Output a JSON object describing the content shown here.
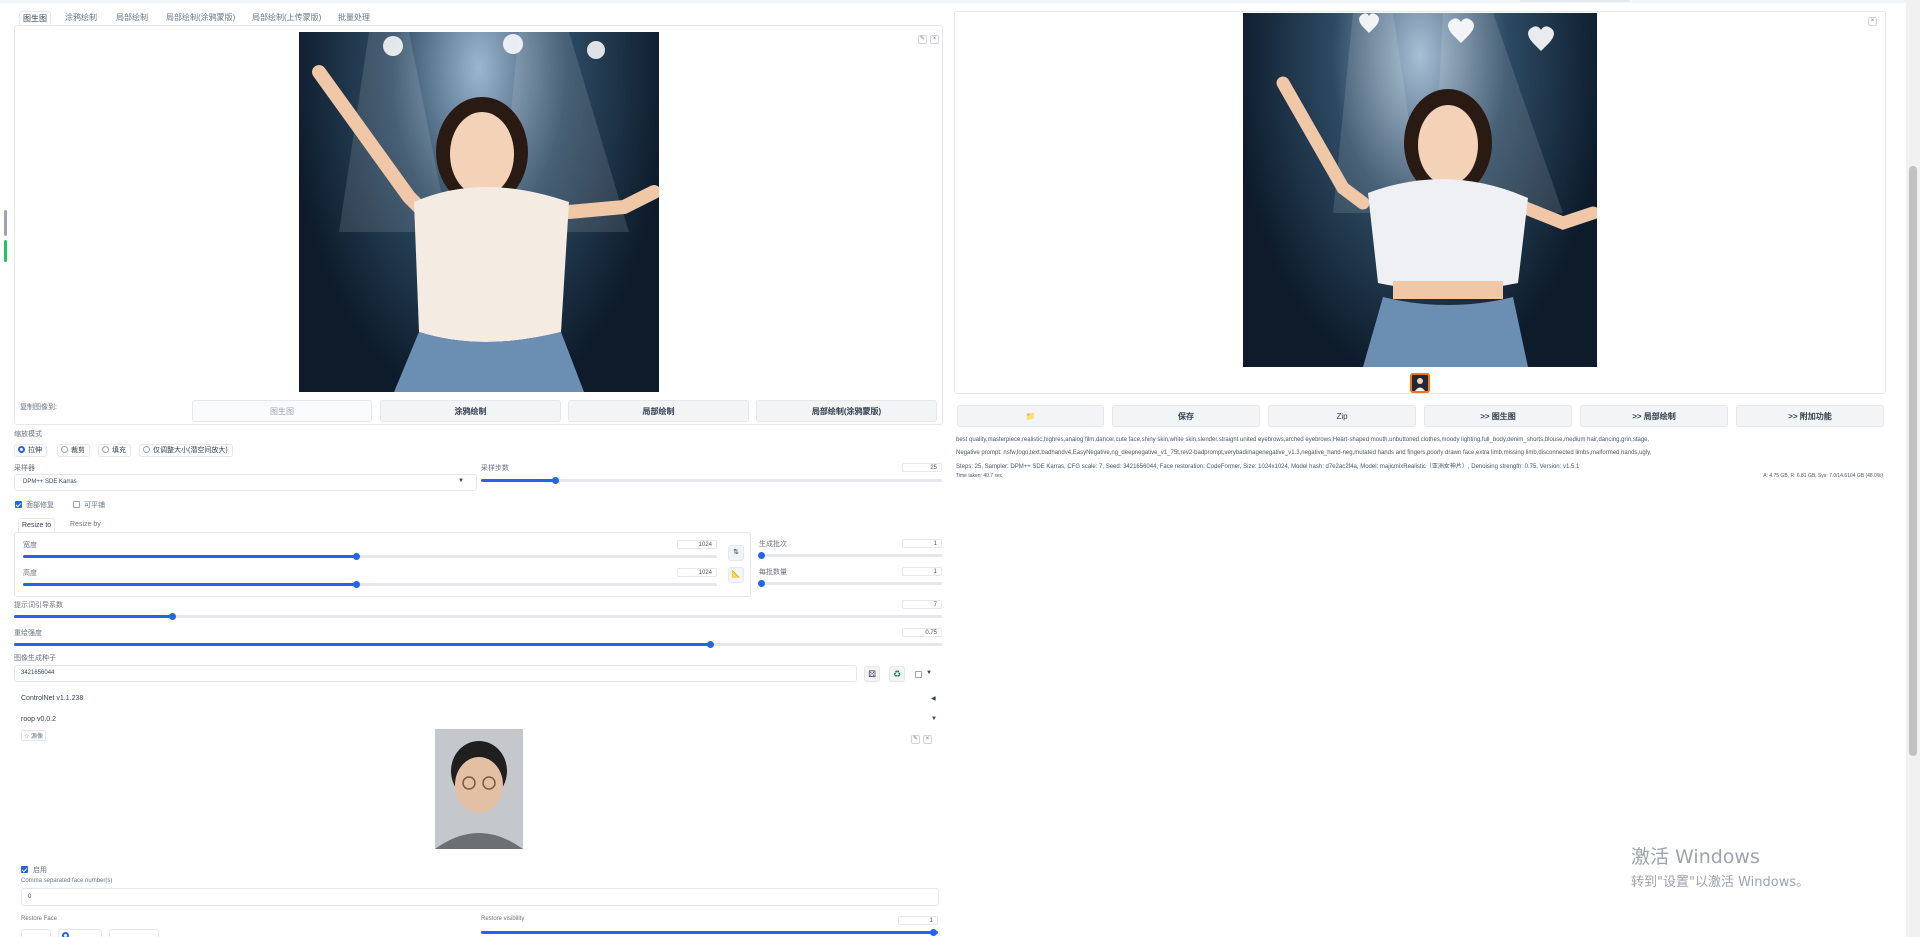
{
  "tabs": [
    "图生图",
    "涂鸦绘制",
    "局部绘制",
    "局部绘制(涂鸦蒙版)",
    "局部绘制(上传蒙版)",
    "批量处理"
  ],
  "copy_image": {
    "label": "复制图像到:",
    "buttons": [
      "图生图",
      "涂鸦绘制",
      "局部绘制",
      "局部绘制(涂鸦蒙版)"
    ]
  },
  "resize_mode": {
    "label": "缩放模式",
    "options": [
      "拉伸",
      "裁剪",
      "填充",
      "仅调整大小(潜空间放大)"
    ],
    "selected": "拉伸"
  },
  "sampler": {
    "label": "采样器",
    "value": "DPM++ SDE Karras"
  },
  "steps": {
    "label": "采样步数",
    "value": "25",
    "fraction": 0.16
  },
  "checks": {
    "restore_faces": "面部修复",
    "tiling": "可平铺"
  },
  "resize_tabs": [
    "Resize to",
    "Resize by"
  ],
  "width": {
    "label": "宽度",
    "value": "1024",
    "fraction": 0.48
  },
  "height": {
    "label": "高度",
    "value": "1024",
    "fraction": 0.48
  },
  "batch_count": {
    "label": "生成批次",
    "value": "1",
    "fraction": 0.0
  },
  "batch_size": {
    "label": "每批数量",
    "value": "1",
    "fraction": 0.0
  },
  "cfg": {
    "label": "提示词引导系数",
    "value": "7",
    "fraction": 0.21
  },
  "denoise": {
    "label": "重绘强度",
    "value": "0.75",
    "fraction": 0.75
  },
  "seed": {
    "label": "图像生成种子",
    "value": "3421656044"
  },
  "controlnet": {
    "label": "ControlNet v1.1.238",
    "arrow": "◀"
  },
  "roop": {
    "label": "roop v0.0.2",
    "arrow": "▼",
    "source_label": "☆ 源像",
    "enable": "启用",
    "face_numbers_label": "Comma separated face number(s)",
    "face_numbers_value": "0",
    "restore_face": "Restore Face",
    "restore_visibility": "Restore visibility",
    "restore_visibility_value": "1"
  },
  "output_buttons": [
    "📁",
    "保存",
    "Zip",
    ">> 图生图",
    ">> 局部绘制",
    ">> 附加功能"
  ],
  "generation_info": {
    "prompt": "best quality,masterpiece,realistic,highres,analog film,dancer,cute face,shiny skin,white skin,slender,straight united eyebrows,arched eyebrows,Heart-shaped mouth,unbuttoned clothes,moody lighting,full_body,denim_shorts,blouse,medium hair,dancing,grin,stage,",
    "negative": "Negative prompt: nsfw,logo,text,badhandv4,EasyNegative,ng_deepnegative_v1_75t,rev2-badprompt,verybadimagenegative_v1.3,negative_hand-neg,mutated hands and fingers,poorly drawn face,extra limb,missing limb,disconnected limbs,malformed hands,ugly,",
    "params": "Steps: 25, Sampler: DPM++ SDE Karras, CFG scale: 7, Seed: 3421656044, Face restoration: CodeFormer, Size: 1024x1024, Model hash: d7e2ac2f4a, Model: majicmixRealistic（亚洲女神片）, Denoising strength: 0.75, Version: v1.5.1",
    "time": "Time taken: 40.7 sec.",
    "vram": "A: 4.75 GB, R: 6.81 GB, Sys: 7.0/14.6104 GB (48.0%)"
  },
  "watermark": {
    "line1": "激活 Windows",
    "line2": "转到\"设置\"以激活 Windows。"
  },
  "colors": {
    "accent": "#2563eb",
    "border": "#e5e7eb"
  }
}
